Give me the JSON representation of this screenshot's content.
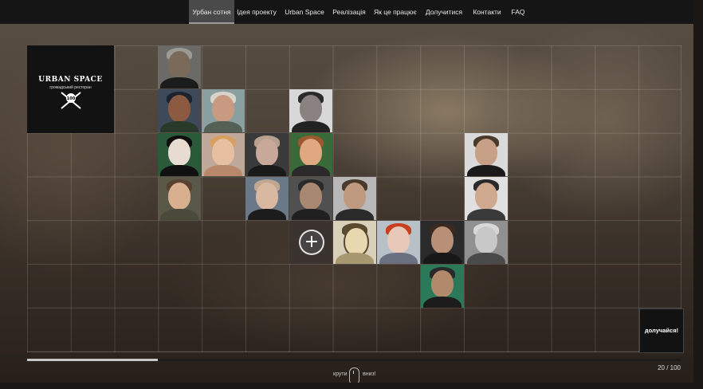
{
  "nav": {
    "items": [
      {
        "label": "Урбан сотня",
        "active": true
      },
      {
        "label": "Ідея проекту",
        "active": false
      },
      {
        "label": "Urban Space",
        "active": false
      },
      {
        "label": "Реалізація",
        "active": false
      },
      {
        "label": "Як це працює",
        "active": false
      },
      {
        "label": "Долучитися",
        "active": false
      },
      {
        "label": "Контакти",
        "active": false
      },
      {
        "label": "FAQ",
        "active": false
      }
    ]
  },
  "logo": {
    "title": "URBAN SPACE",
    "subtitle": "громадський ресторан",
    "badge": "100"
  },
  "join_button": "долучайся!",
  "progress": {
    "counter": "20 / 100",
    "current": 20,
    "total": 100
  },
  "scroll_hint": {
    "left": "крути",
    "right": "вниз!"
  },
  "add_tile": {
    "icon": "plus-icon"
  },
  "colors": {
    "nav_bg": "#151515",
    "nav_active": "#4a4a4a",
    "tile_dark": "#121212"
  }
}
